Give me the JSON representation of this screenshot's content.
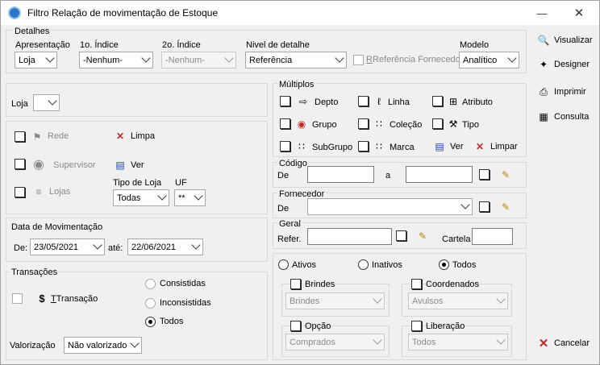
{
  "window": {
    "title": "Filtro Relação de movimentação de Estoque"
  },
  "detalhes": {
    "title": "Detalhes",
    "apresentacao": {
      "label": "Apresentação",
      "value": "Loja"
    },
    "indice1": {
      "label": "1o. Índice",
      "value": "-Nenhum-"
    },
    "indice2": {
      "label": "2o. Índice",
      "value": "-Nenhum-"
    },
    "nivel": {
      "label": "Nivel de detalhe",
      "value": "Referência"
    },
    "ref_fornecedor": "Referência Fornecedor",
    "modelo": {
      "label": "Modelo",
      "value": "Analítico"
    }
  },
  "actions": {
    "visualizar": "Visualizar",
    "designer": "Designer",
    "imprimir": "Imprimir",
    "consulta": "Consulta",
    "cancelar": "Cancelar"
  },
  "loja": {
    "label": "Loja"
  },
  "lojas_panel": {
    "rede": "Rede",
    "limpa": "Limpa",
    "supervisor": "Supervisor",
    "ver": "Ver",
    "lojas": "Lojas",
    "tipo_loja": {
      "label": "Tipo de Loja",
      "value": "Todas"
    },
    "uf": {
      "label": "UF",
      "value": "**"
    }
  },
  "data": {
    "title": "Data de Movimentação",
    "de_label": "De:",
    "de": "23/05/2021",
    "ate_label": "até:",
    "ate": "22/06/2021"
  },
  "transacoes": {
    "title": "Transações",
    "transacao": "Transação",
    "consistidas": "Consistidas",
    "inconsistidas": "Inconsistidas",
    "todos": "Todos",
    "valorizacao": {
      "label": "Valorização",
      "value": "Não valorizado"
    }
  },
  "multiplos": {
    "title": "Múltiplos",
    "depto": "Depto",
    "linha": "Linha",
    "atributo": "Atributo",
    "grupo": "Grupo",
    "colecao": "Coleção",
    "tipo": "Tipo",
    "subgrupo": "SubGrupo",
    "marca": "Marca",
    "ver": "Ver",
    "limpar": "Limpar"
  },
  "codigo": {
    "title": "Código",
    "de": "De",
    "a": "a"
  },
  "fornecedor": {
    "title": "Fornecedor",
    "de": "De"
  },
  "geral": {
    "title": "Geral",
    "refer": "Refer.",
    "cartela": "Cartela"
  },
  "status": {
    "ativos": "Ativos",
    "inativos": "Inativos",
    "todos": "Todos"
  },
  "brindes": {
    "label": "Brindes",
    "value": "Brindes"
  },
  "coordenados": {
    "label": "Coordenados",
    "value": "Avulsos"
  },
  "opcao": {
    "label": "Opção",
    "value": "Comprados"
  },
  "liberacao": {
    "label": "Liberação",
    "value": "Todos"
  }
}
